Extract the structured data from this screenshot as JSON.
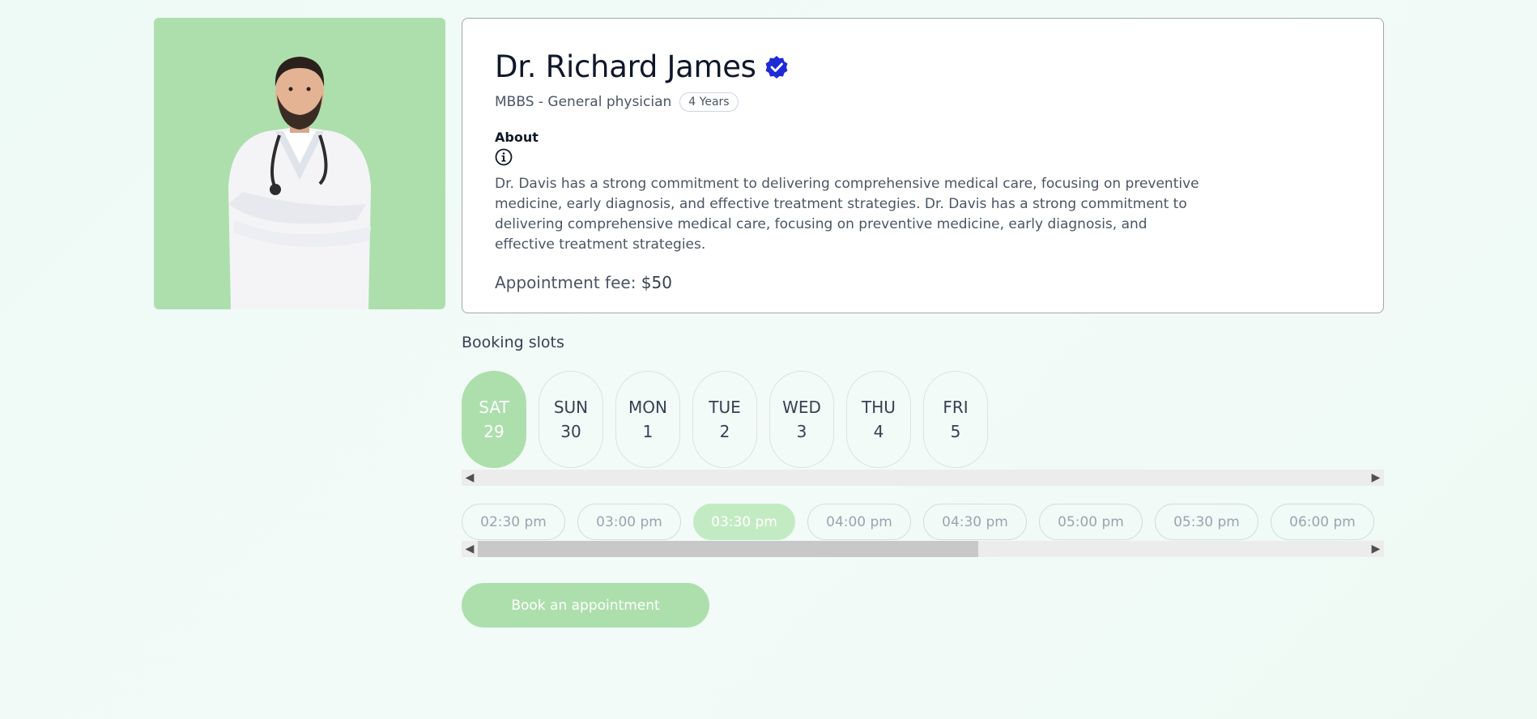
{
  "doctor": {
    "name": "Dr. Richard James",
    "degree": "MBBS - General physician",
    "experience": "4 Years",
    "about_label": "About",
    "about_text": "Dr. Davis has a strong commitment to delivering comprehensive medical care, focusing on preventive medicine, early diagnosis, and effective treatment strategies. Dr. Davis has a strong commitment to delivering comprehensive medical care, focusing on preventive medicine, early diagnosis, and effective treatment strategies.",
    "fee_label": "Appointment fee:",
    "fee_value": "$50"
  },
  "booking": {
    "title": "Booking slots",
    "days": [
      {
        "day": "SAT",
        "date": "29",
        "selected": true
      },
      {
        "day": "SUN",
        "date": "30",
        "selected": false
      },
      {
        "day": "MON",
        "date": "1",
        "selected": false
      },
      {
        "day": "TUE",
        "date": "2",
        "selected": false
      },
      {
        "day": "WED",
        "date": "3",
        "selected": false
      },
      {
        "day": "THU",
        "date": "4",
        "selected": false
      },
      {
        "day": "FRI",
        "date": "5",
        "selected": false
      }
    ],
    "times": [
      "02:30 pm",
      "03:00 pm",
      "03:30 pm",
      "04:00 pm",
      "04:30 pm",
      "05:00 pm",
      "05:30 pm",
      "06:00 pm"
    ],
    "selected_time": "03:30 pm",
    "times_scroll_visible_fraction": 0.55,
    "button_label": "Book an appointment"
  },
  "colors": {
    "accent": "#addfad",
    "verified": "#1d2bd6",
    "selected_time": "#c3ebc3"
  },
  "icons": {
    "verified": "verified-badge-icon",
    "info": "info-icon",
    "scroll_left": "chevron-left-icon",
    "scroll_right": "chevron-right-icon"
  }
}
